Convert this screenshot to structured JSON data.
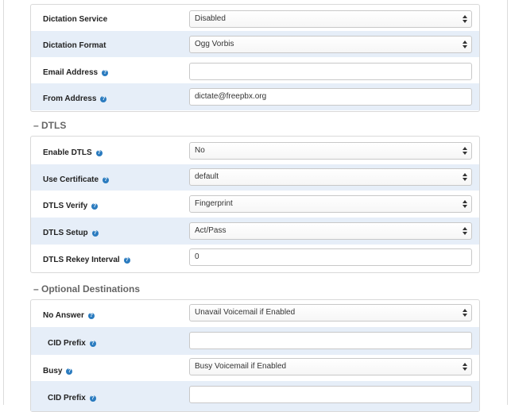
{
  "voicemail": {
    "rows": [
      {
        "label": "Dictation Service",
        "value": "Disabled"
      },
      {
        "label": "Dictation Format",
        "value": "Ogg Vorbis"
      },
      {
        "label": "Email Address",
        "value": ""
      },
      {
        "label": "From Address",
        "value": "dictate@freepbx.org"
      }
    ]
  },
  "dtls": {
    "title": "– DTLS",
    "rows": [
      {
        "label": "Enable DTLS",
        "value": "No"
      },
      {
        "label": "Use Certificate",
        "value": "default"
      },
      {
        "label": "DTLS Verify",
        "value": "Fingerprint"
      },
      {
        "label": "DTLS Setup",
        "value": "Act/Pass"
      },
      {
        "label": "DTLS Rekey Interval",
        "value": "0"
      }
    ]
  },
  "optional_destinations": {
    "title": "– Optional Destinations",
    "rows": [
      {
        "label": "No Answer",
        "value": "Unavail Voicemail if Enabled"
      },
      {
        "label": "CID Prefix",
        "value": ""
      },
      {
        "label": "Busy",
        "value": "Busy Voicemail if Enabled"
      },
      {
        "label": "CID Prefix",
        "value": ""
      }
    ]
  },
  "help_glyph": "?",
  "colors": {
    "row_highlight": "#e6eef8",
    "help_icon": "#2a7bbf"
  }
}
